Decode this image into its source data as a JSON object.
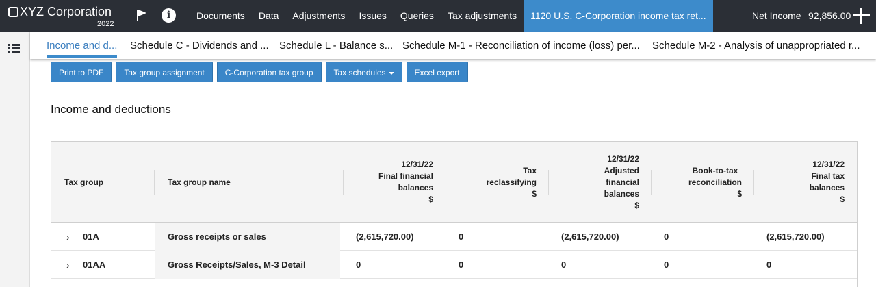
{
  "app": {
    "company": "XYZ Corporation",
    "year": "2022"
  },
  "icons": {
    "flag": "flag-icon",
    "info": "info-icon",
    "add": "plus-icon",
    "menu": "hamburger-menu-icon",
    "expand": "chevron-right-icon"
  },
  "colors": {
    "topbar": "#2b2f36",
    "accent": "#3d8bcb",
    "button": "#3a86c8"
  },
  "nav": {
    "items": [
      "Documents",
      "Data",
      "Adjustments",
      "Issues",
      "Queries",
      "Tax adjustments",
      "1120 U.S. C-Corporation income tax ret..."
    ],
    "active_index": 6,
    "net_income_label": "Net Income",
    "net_income_value": "92,856.00"
  },
  "subtabs": {
    "items": [
      "Income and d...",
      "Schedule C - Dividends and ...",
      "Schedule L - Balance s...",
      "Schedule M-1 - Reconciliation of income (loss) per...",
      "Schedule M-2 - Analysis of unappropriated r..."
    ],
    "active_index": 0
  },
  "toolbar": {
    "print": "Print to PDF",
    "tax_group_assignment": "Tax group assignment",
    "ccorp_tax_group": "C-Corporation tax group",
    "tax_schedules": "Tax schedules",
    "excel_export": "Excel export"
  },
  "section_title": "Income and deductions",
  "table": {
    "columns": {
      "tax_group": "Tax group",
      "tax_group_name": "Tax group name",
      "final_financial": [
        "12/31/22",
        "Final financial",
        "balances",
        "$"
      ],
      "tax_reclass": [
        "Tax",
        "reclassifying",
        "$"
      ],
      "adjusted_financial": [
        "12/31/22",
        "Adjusted",
        "financial",
        "balances",
        "$"
      ],
      "book_to_tax": [
        "Book-to-tax",
        "reconciliation",
        "$"
      ],
      "final_tax": [
        "12/31/22",
        "Final tax",
        "balances",
        "$"
      ]
    },
    "rows": [
      {
        "group": "01A",
        "name": "Gross receipts or sales",
        "final_financial": "(2,615,720.00)",
        "reclass": "0",
        "adjusted": "(2,615,720.00)",
        "book_to_tax": "0",
        "final_tax": "(2,615,720.00)"
      },
      {
        "group": "01AA",
        "name": "Gross Receipts/Sales, M-3 Detail",
        "final_financial": "0",
        "reclass": "0",
        "adjusted": "0",
        "book_to_tax": "0",
        "final_tax": "0"
      }
    ]
  }
}
